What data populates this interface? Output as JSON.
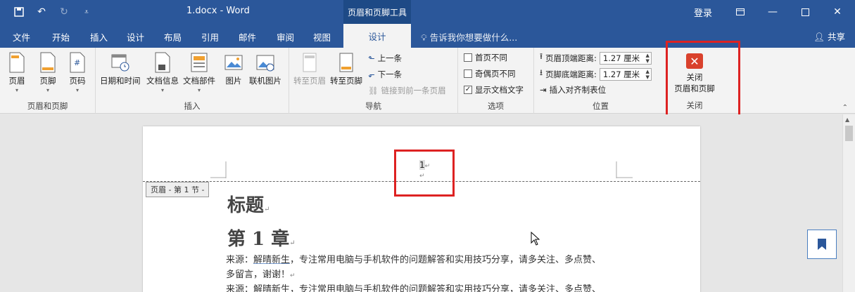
{
  "window": {
    "title": "1.docx  -  Word",
    "context_tools": "页眉和页脚工具",
    "login": "登录"
  },
  "tabs": [
    "文件",
    "开始",
    "插入",
    "设计",
    "布局",
    "引用",
    "邮件",
    "审阅",
    "视图"
  ],
  "active_tab": "设计",
  "tell_me": "告诉我你想要做什么...",
  "share": "共享",
  "ribbon": {
    "header_footer_group": {
      "label": "页眉和页脚",
      "header": "页眉",
      "footer": "页脚",
      "page_number": "页码"
    },
    "insert_group": {
      "label": "插入",
      "date_time": "日期和时间",
      "doc_info": "文档信息",
      "doc_parts": "文档部件",
      "picture": "图片",
      "online_picture": "联机图片"
    },
    "navigation_group": {
      "label": "导航",
      "goto_header": "转至页眉",
      "goto_footer": "转至页脚",
      "previous": "上一条",
      "next": "下一条",
      "link_previous": "链接到前一条页眉"
    },
    "options_group": {
      "label": "选项",
      "different_first": "首页不同",
      "different_odd_even": "奇偶页不同",
      "show_doc_text": "显示文档文字",
      "different_first_checked": false,
      "different_odd_even_checked": false,
      "show_doc_text_checked": true
    },
    "position_group": {
      "label": "位置",
      "header_top": "页眉顶端距离:",
      "footer_bottom": "页脚底端距离:",
      "header_top_value": "1.27 厘米",
      "footer_bottom_value": "1.27 厘米",
      "insert_align_tab": "插入对齐制表位"
    },
    "close_group": {
      "label": "关闭",
      "close_line1": "关闭",
      "close_line2": "页眉和页脚"
    }
  },
  "document": {
    "header_tag": "页眉 - 第 1 节 -",
    "header_page_number": "1",
    "heading_title": "标题",
    "heading_chapter": "第 1 章",
    "para1_prefix": "来源：",
    "para1_link": "解晴新生",
    "para1_rest": "，专注常用电脑与手机软件的问题解答和实用技巧分享，请多关注、多点赞、",
    "para1_line2": "多留言，谢谢！",
    "para2": "来源：解晴新生，专注常用电脑与手机软件的问题解答和实用技巧分享，请多关注、多点赞、"
  },
  "colors": {
    "title_bar": "#2b579a",
    "context_tab": "#1e4a86",
    "highlight": "#dd2222",
    "close_icon": "#d9412c"
  }
}
